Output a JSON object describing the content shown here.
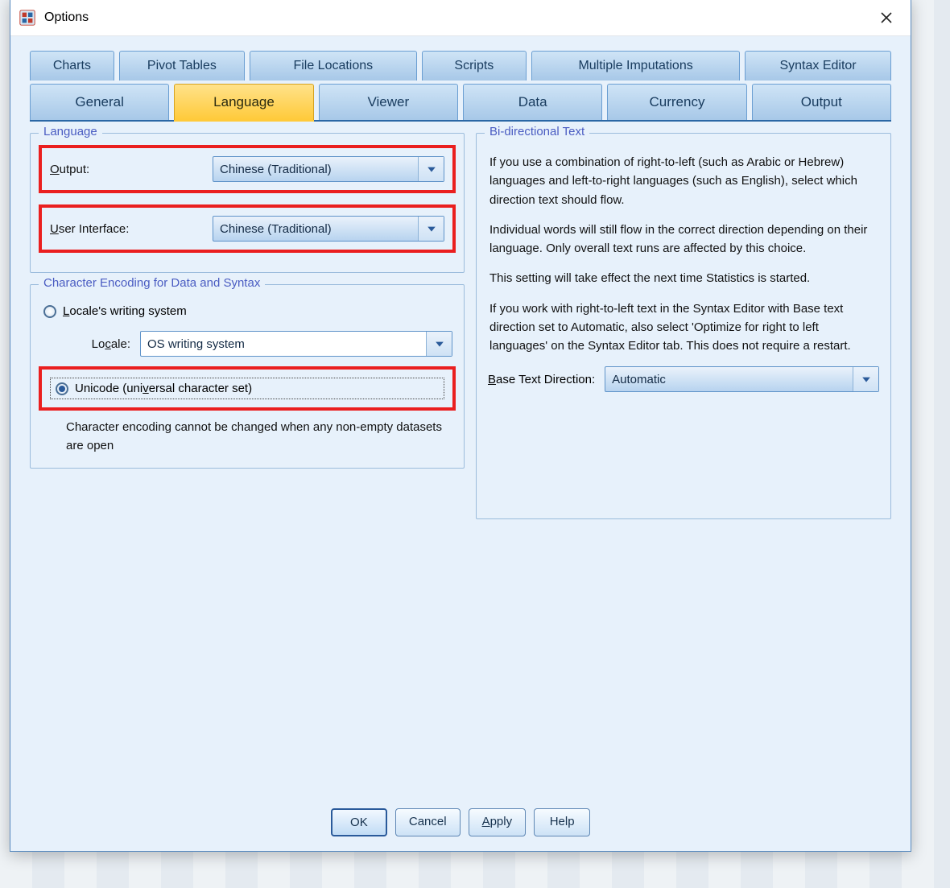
{
  "window": {
    "title": "Options"
  },
  "tabs": {
    "row1": [
      {
        "label": "Charts"
      },
      {
        "label": "Pivot Tables"
      },
      {
        "label": "File Locations"
      },
      {
        "label": "Scripts"
      },
      {
        "label": "Multiple Imputations"
      },
      {
        "label": "Syntax Editor"
      }
    ],
    "row2": [
      {
        "label": "General"
      },
      {
        "label": "Language",
        "active": true
      },
      {
        "label": "Viewer"
      },
      {
        "label": "Data"
      },
      {
        "label": "Currency"
      },
      {
        "label": "Output"
      }
    ]
  },
  "language": {
    "legend": "Language",
    "output_label": "Output:",
    "output_value": "Chinese (Traditional)",
    "ui_label": "User Interface:",
    "ui_value": "Chinese (Traditional)"
  },
  "encoding": {
    "legend": "Character Encoding for Data and Syntax",
    "option_locale": "Locale's writing system",
    "locale_label": "Locale:",
    "locale_value": "OS writing system",
    "option_unicode": "Unicode (universal character set)",
    "note": "Character encoding cannot be changed when any non-empty datasets are open"
  },
  "bidi": {
    "legend": "Bi-directional Text",
    "p1": "If you use a combination of right-to-left (such as Arabic or Hebrew) languages and left-to-right languages (such as English), select which direction text should flow.",
    "p2": "Individual words will still flow in the correct direction depending on their language. Only overall text runs are affected by this choice.",
    "p3": "This setting will take effect the next time Statistics is started.",
    "p4": "If you work with right-to-left text in the Syntax Editor with Base text direction set to Automatic, also select 'Optimize for right to left languages' on the Syntax Editor tab. This does not require a restart.",
    "base_label": "Base Text Direction:",
    "base_value": "Automatic"
  },
  "buttons": {
    "ok": "OK",
    "cancel": "Cancel",
    "apply": "Apply",
    "help": "Help"
  }
}
